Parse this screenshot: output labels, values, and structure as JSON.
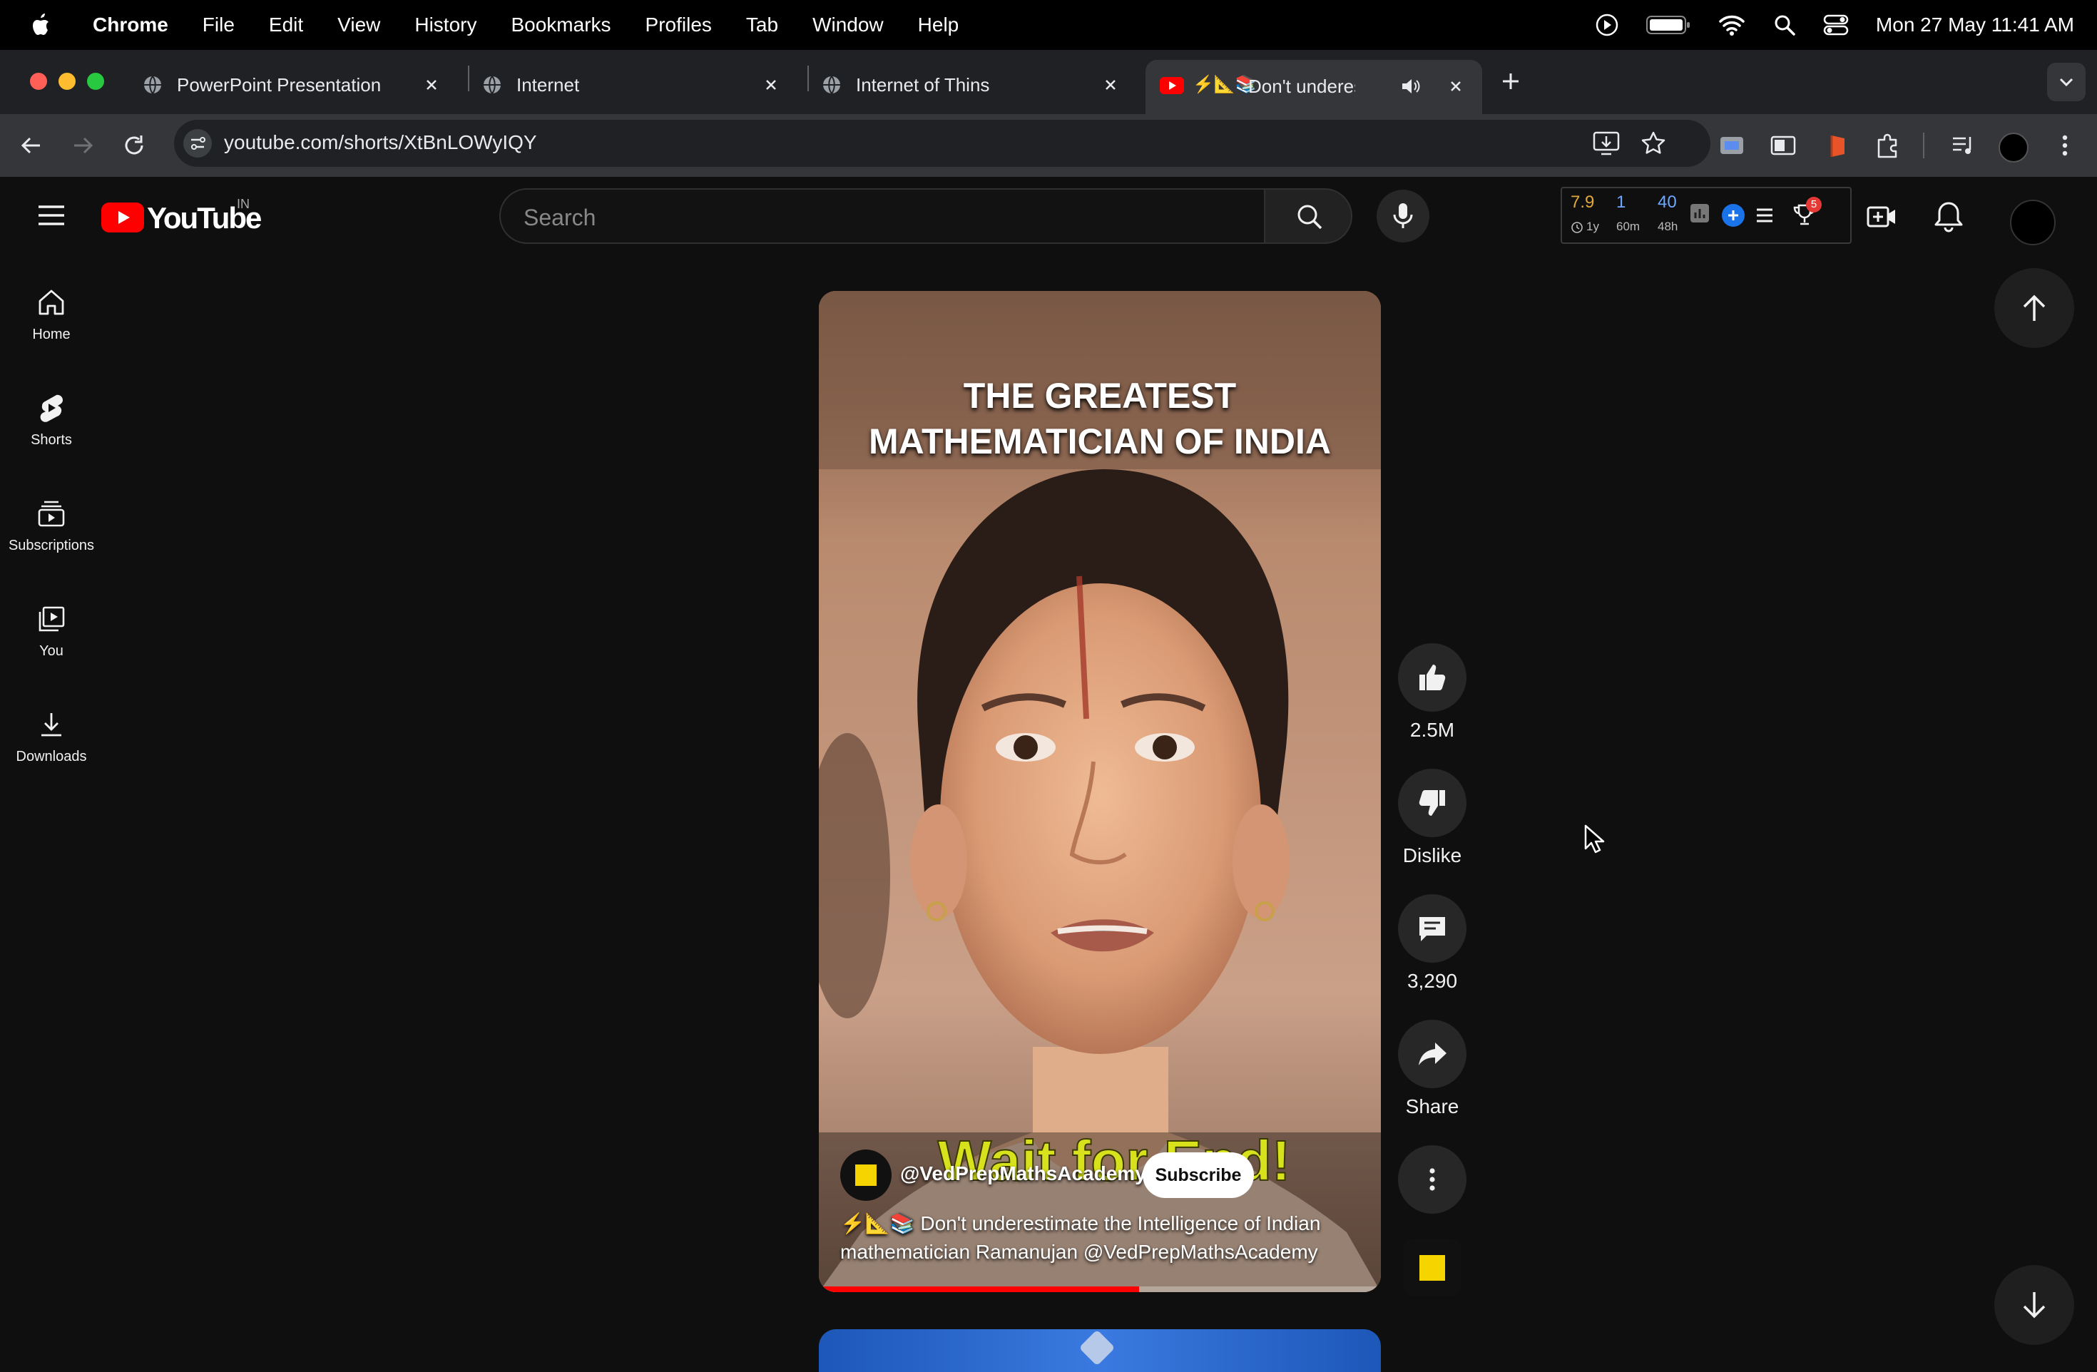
{
  "menubar": {
    "app_name": "Chrome",
    "items": [
      "File",
      "Edit",
      "View",
      "History",
      "Bookmarks",
      "Profiles",
      "Tab",
      "Window",
      "Help"
    ],
    "clock": "Mon 27 May  11:41 AM"
  },
  "tabs": [
    {
      "title": "PowerPoint Presentation"
    },
    {
      "title": "Internet"
    },
    {
      "title": "Internet of Thins"
    },
    {
      "title": "Don't underestim",
      "emoji": "⚡📐📚",
      "active": true
    }
  ],
  "toolbar": {
    "url": "youtube.com/shorts/XtBnLOWyIQY"
  },
  "youtube": {
    "logo_text": "YouTube",
    "country_code": "IN",
    "search_placeholder": "Search",
    "guide": [
      {
        "label": "Home",
        "icon": "home-icon"
      },
      {
        "label": "Shorts",
        "icon": "shorts-icon"
      },
      {
        "label": "Subscriptions",
        "icon": "subscriptions-icon"
      },
      {
        "label": "You",
        "icon": "you-icon"
      },
      {
        "label": "Downloads",
        "icon": "download-icon"
      }
    ],
    "extension_stats": {
      "a_value": "7.9",
      "a_sub": "1y",
      "b_value": "1",
      "b_sub": "60m",
      "c_value": "40",
      "c_sub": "48h",
      "badge": "5"
    }
  },
  "short": {
    "overlay_title_line1": "THE GREATEST",
    "overlay_title_line2": "MATHEMATICIAN OF INDIA",
    "overlay_caption": "Wait for End!",
    "channel": "@VedPrepMathsAcademy",
    "subscribe_label": "Subscribe",
    "description_line1": "⚡📐📚 Don't underestimate the Intelligence of Indian",
    "description_line2": "mathematician Ramanujan @VedPrepMathsAcademy",
    "progress": 0.57,
    "likes": "2.5M",
    "dislike_label": "Dislike",
    "comments": "3,290",
    "share_label": "Share"
  },
  "colors": {
    "yt_red": "#ff0000",
    "background": "#0f0f0f",
    "caption_yellow": "#d8e21c"
  }
}
